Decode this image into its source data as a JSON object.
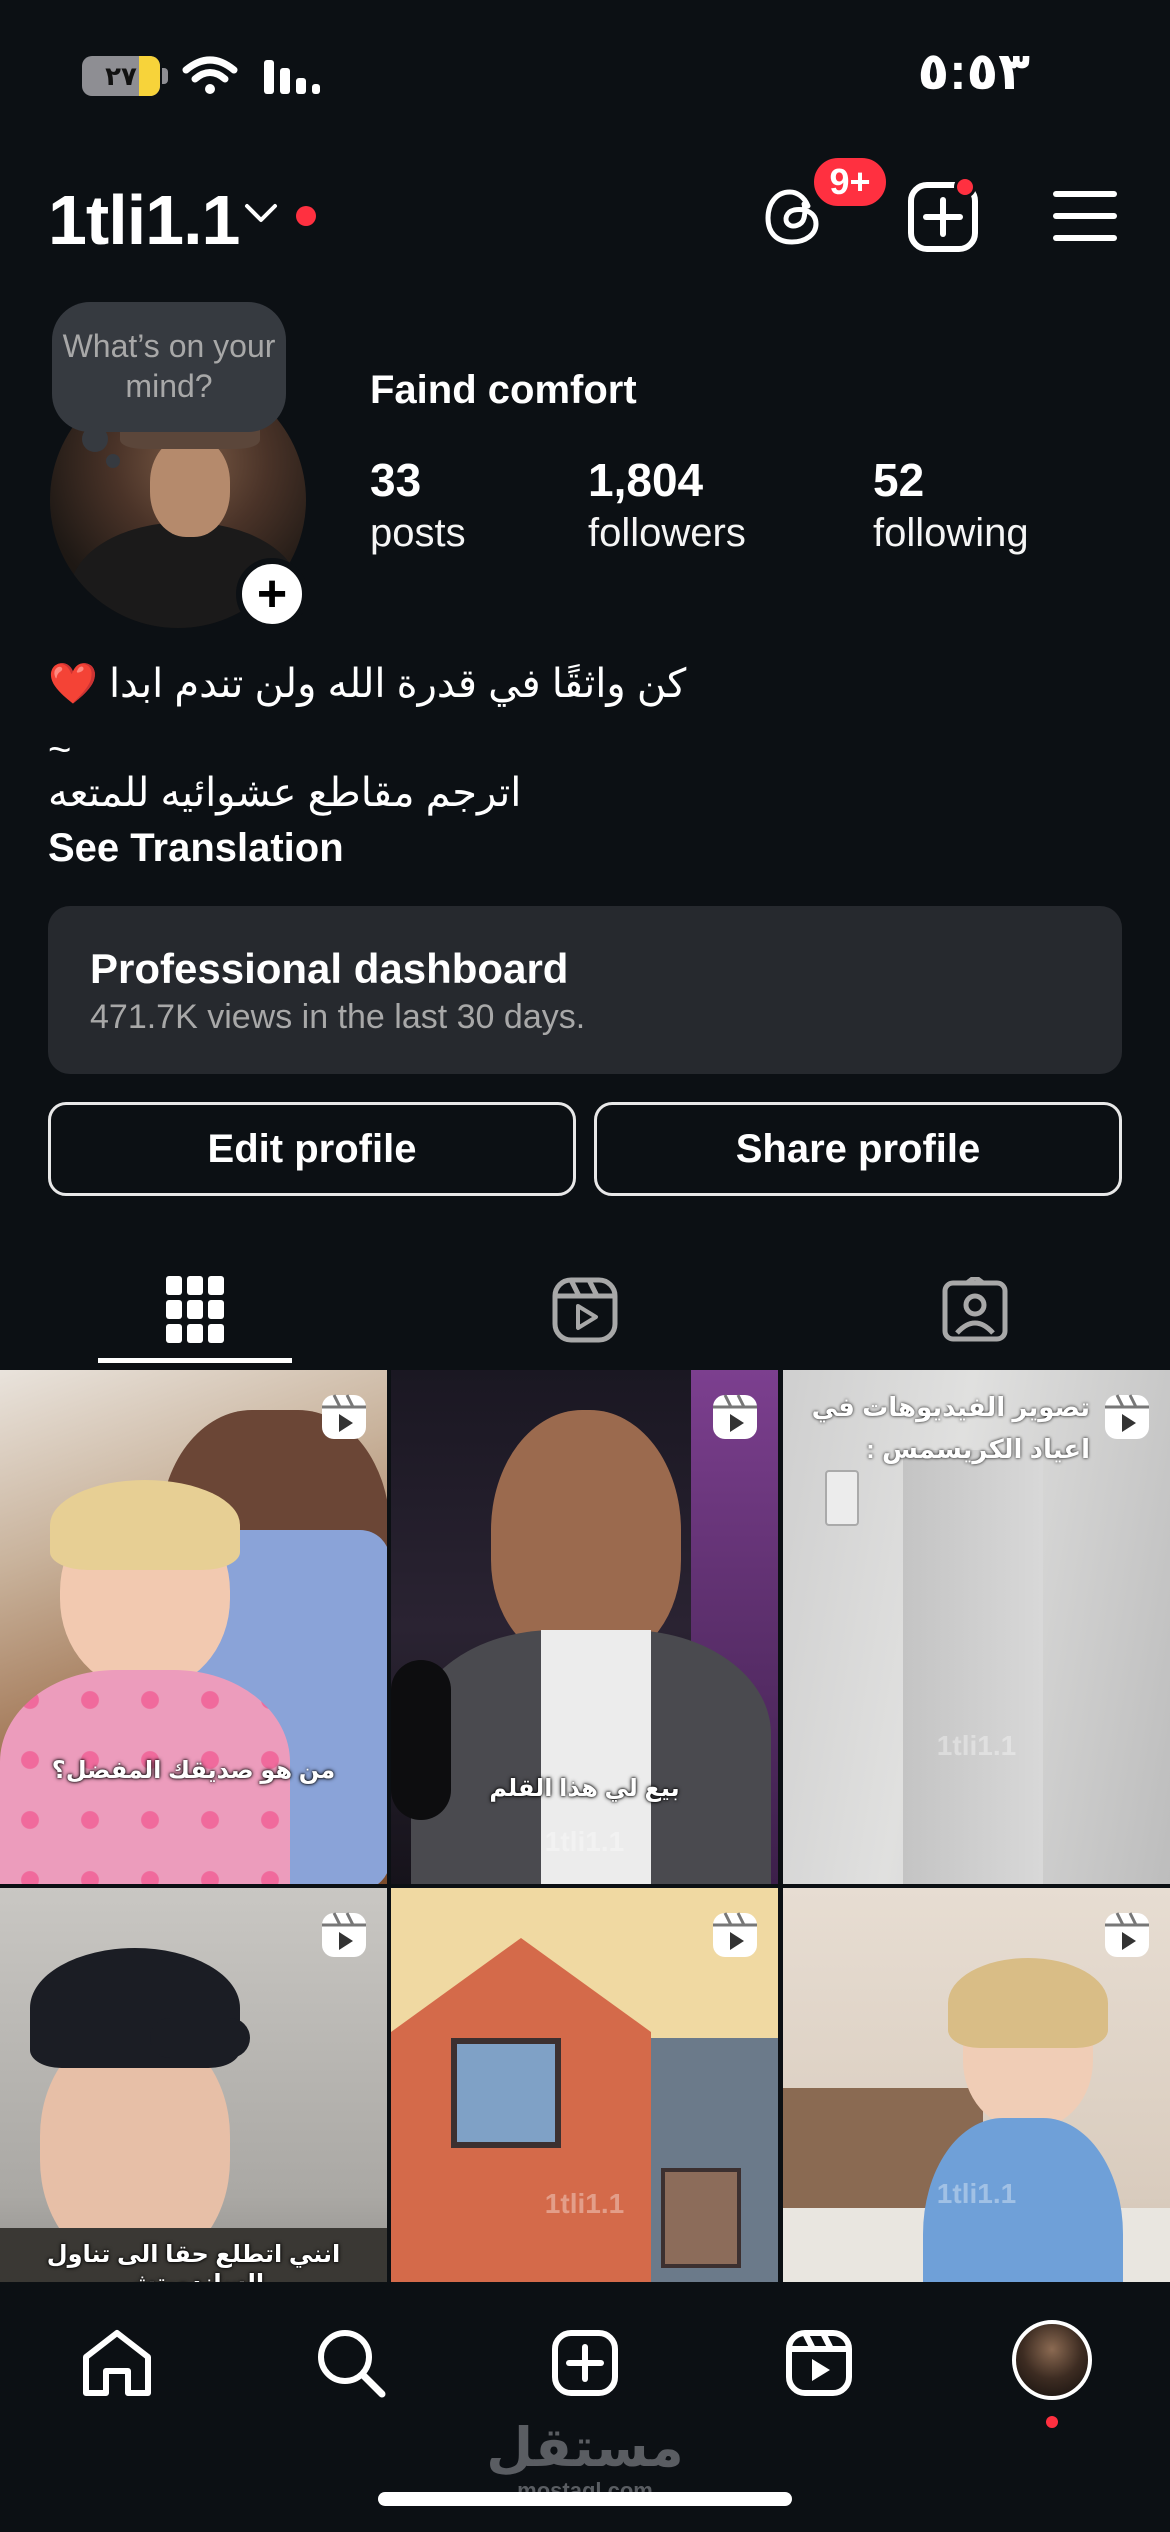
{
  "status_bar": {
    "time": "٥:٥٣",
    "battery": "٢٧",
    "battery_level": 0.27,
    "icons": [
      "wifi-icon",
      "signal-icon"
    ]
  },
  "header": {
    "username": "1tli1.1",
    "threads_badge": "9+",
    "icons": [
      "chevron-down-icon",
      "threads-icon",
      "create-icon",
      "menu-icon"
    ]
  },
  "profile": {
    "note_text": "What’s on your mind?",
    "display_name": "Faind comfort",
    "stats": [
      {
        "value": "33",
        "label": "posts"
      },
      {
        "value": "1,804",
        "label": "followers"
      },
      {
        "value": "52",
        "label": "following"
      }
    ],
    "bio_line1": "كن واثقًا في قدرة الله ولن تندم ابدا",
    "bio_emoji": "❤️",
    "bio_line2": "~",
    "bio_line3": "اترجم مقاطع عشوائيه للمتعه",
    "see_translation": "See Translation"
  },
  "dashboard": {
    "title": "Professional dashboard",
    "subtitle": "471.7K views in the last 30 days."
  },
  "actions": {
    "edit_profile": "Edit profile",
    "share_profile": "Share profile"
  },
  "tabs": [
    {
      "icon": "grid-icon",
      "active": true
    },
    {
      "icon": "reels-icon",
      "active": false
    },
    {
      "icon": "tagged-icon",
      "active": false
    }
  ],
  "grid": {
    "watermark": "1tli1.1",
    "tiles": [
      {
        "caption": "من هو صديقك المفضل؟",
        "top_caption": ""
      },
      {
        "caption": "بيع لي هذا القلم",
        "top_caption": ""
      },
      {
        "caption": "",
        "top_caption": "تصوير الفيديوهات في اعياد الكريسمس :"
      },
      {
        "caption": "انني اتطلع حقا الى تناول الساندويتش",
        "top_caption": ""
      },
      {
        "caption": "",
        "top_caption": ""
      },
      {
        "caption": "",
        "top_caption": ""
      }
    ]
  },
  "bottom_nav": {
    "items": [
      "home-icon",
      "search-icon",
      "create-icon",
      "reels-icon",
      "profile-avatar"
    ],
    "watermark_ar": "مستقل",
    "watermark_en": "mostaql.com"
  },
  "colors": {
    "background": "#0c1014",
    "accent_red": "#ff3040",
    "card": "#26292e"
  }
}
